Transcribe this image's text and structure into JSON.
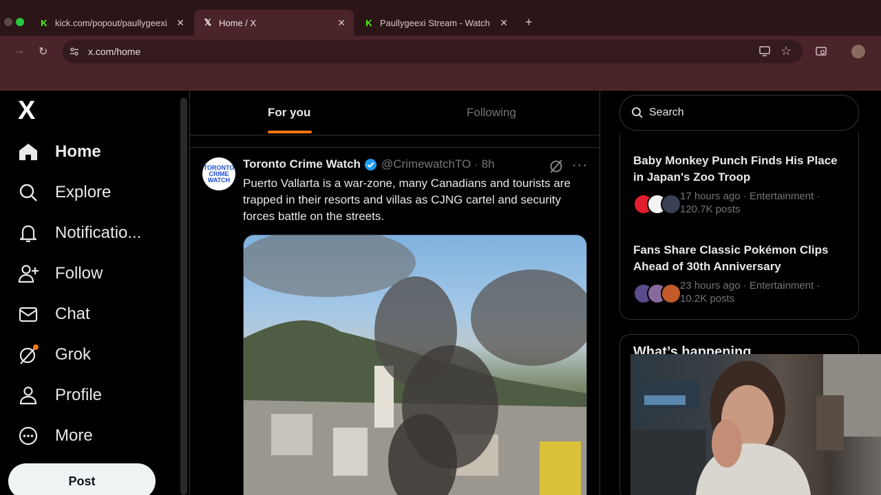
{
  "browser": {
    "tabs": [
      {
        "title": "kick.com/popout/paullygeexi/",
        "favicon": "kick-icon",
        "active": false
      },
      {
        "title": "Home / X",
        "favicon": "x-icon",
        "active": true
      },
      {
        "title": "Paullygeexi Stream - Watch Li",
        "favicon": "kick-icon",
        "active": false
      }
    ],
    "new_tab": "+",
    "url": "x.com/home"
  },
  "sidebar": {
    "logo": "X",
    "items": [
      {
        "label": "Home",
        "icon": "home-icon"
      },
      {
        "label": "Explore",
        "icon": "search-icon"
      },
      {
        "label": "Notificatio...",
        "icon": "bell-icon"
      },
      {
        "label": "Follow",
        "icon": "follow-icon"
      },
      {
        "label": "Chat",
        "icon": "mail-icon"
      },
      {
        "label": "Grok",
        "icon": "grok-icon"
      },
      {
        "label": "Profile",
        "icon": "profile-icon"
      },
      {
        "label": "More",
        "icon": "more-icon"
      }
    ],
    "post_label": "Post"
  },
  "feed": {
    "tabs": [
      "For you",
      "Following"
    ],
    "tweet": {
      "name": "Toronto Crime Watch",
      "handle": "@CrimewatchTO",
      "time": "· 8h",
      "avatar_text": "TORONTO CRIME WATCH",
      "text": "Puerto Vallarta is a war-zone, many Canadians and tourists are trapped in their resorts and villas as CJNG cartel and security forces battle on the  streets."
    }
  },
  "right": {
    "search_placeholder": "Search",
    "trends": [
      {
        "title": "Baby Monkey Punch Finds His Place in Japan's Zoo Troop",
        "meta": "17 hours ago · Entertainment · 120.7K posts"
      },
      {
        "title": "Fans Share Classic Pokémon Clips Ahead of 30th Anniversary",
        "meta": "23 hours ago · Entertainment · 10.2K posts"
      }
    ],
    "whats_happening": "What’s happening"
  },
  "colors": {
    "accent": "#f97316",
    "verified": "#1d9bf0",
    "chrome": "#4a2428"
  }
}
